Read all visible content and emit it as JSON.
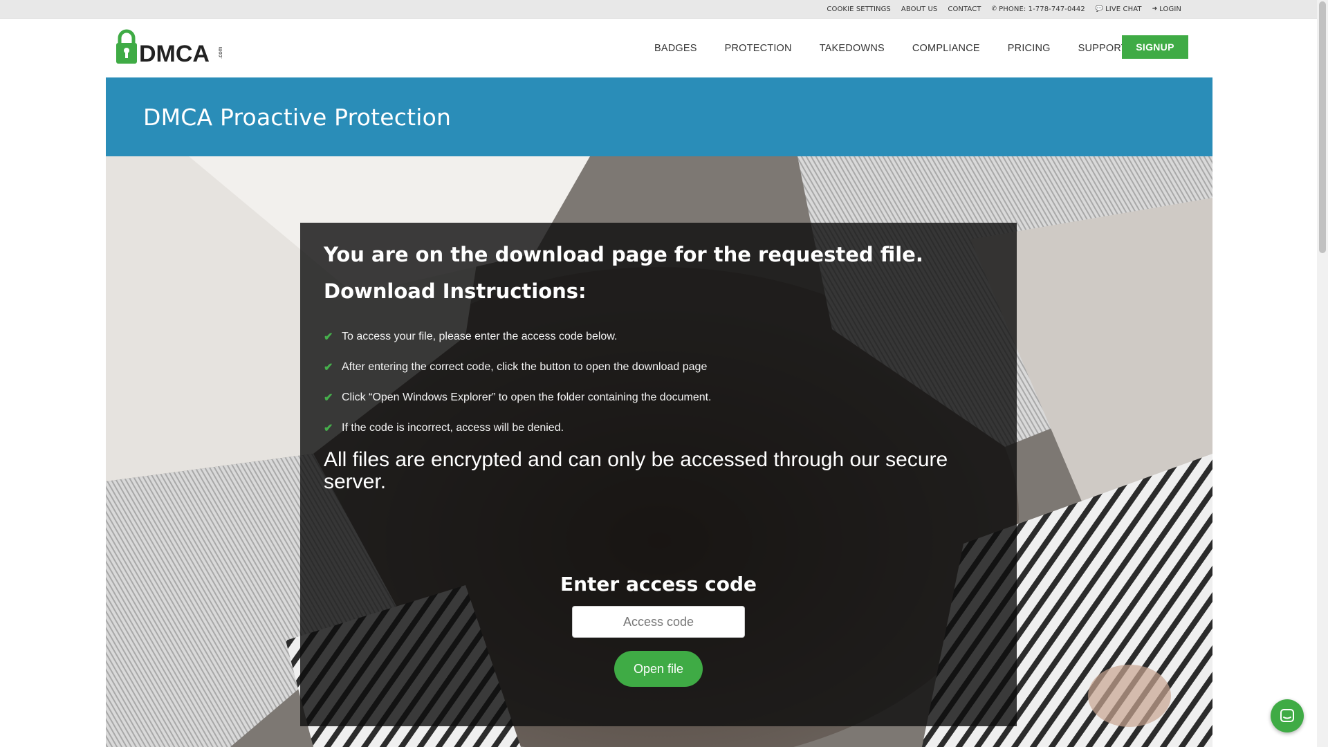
{
  "topbar": {
    "links": [
      {
        "label": "COOKIE SETTINGS"
      },
      {
        "label": "ABOUT US"
      },
      {
        "label": "CONTACT"
      },
      {
        "label": "PHONE: 1-778-747-0442",
        "icon": "phone-icon"
      },
      {
        "label": "LIVE CHAT",
        "icon": "chat-bubble-icon"
      },
      {
        "label": "LOGIN",
        "icon": "login-icon"
      }
    ]
  },
  "header": {
    "logo_text": "DMCA",
    "logo_suffix": ".com",
    "nav": [
      "BADGES",
      "PROTECTION",
      "TAKEDOWNS",
      "COMPLIANCE",
      "PRICING",
      "SUPPORT"
    ],
    "signup_label": "SIGNUP"
  },
  "banner": {
    "title": "DMCA Proactive Protection"
  },
  "card": {
    "heading": "You are on the download page for the requested file.",
    "instructions_heading": "Download Instructions:",
    "steps": [
      "To access your file, please enter the access code below.",
      "After entering the correct code, click the button to open the download page",
      "Click “Open Windows Explorer” to open the folder containing the document.",
      "If the code is incorrect, access will be denied."
    ],
    "encrypted_note": "All files are encrypted and can only be accessed through our secure server.",
    "code_title": "Enter access code",
    "code_placeholder": "Access code",
    "code_value": "",
    "open_button": "Open file"
  },
  "colors": {
    "accent_green": "#3fab45",
    "banner_blue": "#2a8db8",
    "check_green": "#46b04c"
  },
  "icons": {
    "check": "check-icon",
    "chat_widget": "chat-widget-icon"
  }
}
